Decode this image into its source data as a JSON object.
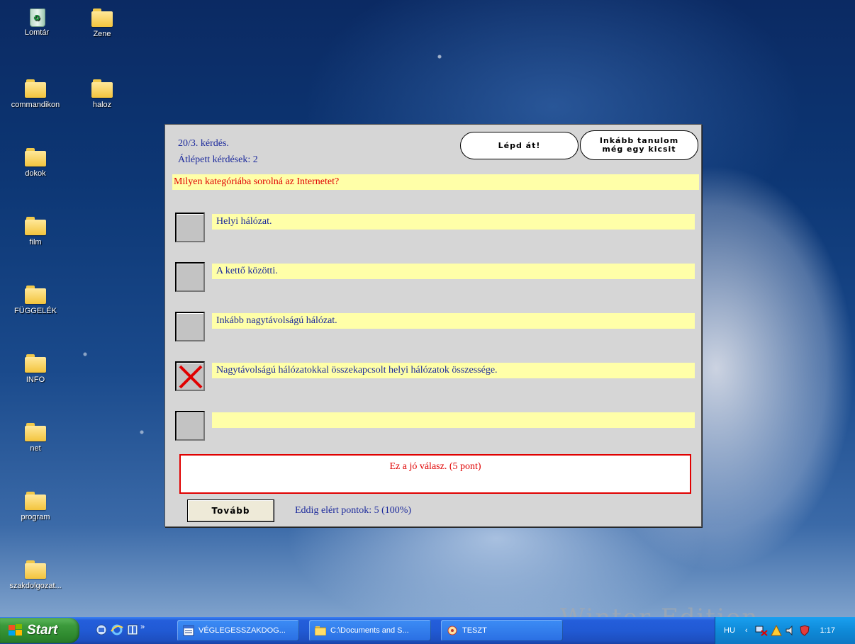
{
  "desktop": {
    "icons": [
      {
        "label": "Lomtár",
        "icon": "recycle-bin-icon"
      },
      {
        "label": "Zene",
        "icon": "folder-icon"
      },
      {
        "label": "commandikon",
        "icon": "folder-icon"
      },
      {
        "label": "haloz",
        "icon": "folder-icon"
      },
      {
        "label": "dokok",
        "icon": "folder-icon"
      },
      {
        "label": "film",
        "icon": "folder-icon"
      },
      {
        "label": "FÜGGELÉK",
        "icon": "folder-icon"
      },
      {
        "label": "INFO",
        "icon": "folder-icon"
      },
      {
        "label": "net",
        "icon": "folder-icon"
      },
      {
        "label": "program",
        "icon": "folder-icon"
      },
      {
        "label": "szakdolgozat...",
        "icon": "folder-icon"
      }
    ],
    "watermark": "Winter Edition"
  },
  "quiz": {
    "question_counter": "20/3. kérdés.",
    "skipped_questions": "Átlépett kérdések: 2",
    "skip_button": "Lépd át!",
    "learn_button_line1": "Inkább tanulom",
    "learn_button_line2": "még egy kicsit",
    "question": "Milyen kategóriába sorolná az Internetet?",
    "answers": [
      {
        "text": "Helyi hálózat.",
        "checked": false
      },
      {
        "text": "A kettő közötti.",
        "checked": false
      },
      {
        "text": "Inkább nagytávolságú hálózat.",
        "checked": false
      },
      {
        "text": "Nagytávolságú hálózatokkal összekapcsolt helyi hálózatok összessége.",
        "checked": true
      },
      {
        "text": "",
        "checked": false
      }
    ],
    "result_message": "Ez a jó válasz. (5 pont)",
    "next_button": "Tovább",
    "points_so_far": "Eddig elért pontok: 5 (100%)",
    "colors": {
      "question_text": "#e00000",
      "answer_text": "#1c2a9c",
      "answer_bg": "#ffffa8",
      "check_mark": "#e00000"
    }
  },
  "taskbar": {
    "start_label": "Start",
    "quick_launch": [
      "desktop-icon",
      "internet-explorer-icon",
      "media-icon"
    ],
    "quick_launch_more": "»",
    "buttons": [
      {
        "label": "VÉGLEGESSZAKDOG...",
        "icon": "word-document-icon"
      },
      {
        "label": "C:\\Documents and S...",
        "icon": "folder-icon"
      },
      {
        "label": "TESZT",
        "icon": "app-icon"
      }
    ],
    "tray": {
      "language": "HU",
      "arrow": "‹",
      "clock": "1:17"
    }
  }
}
